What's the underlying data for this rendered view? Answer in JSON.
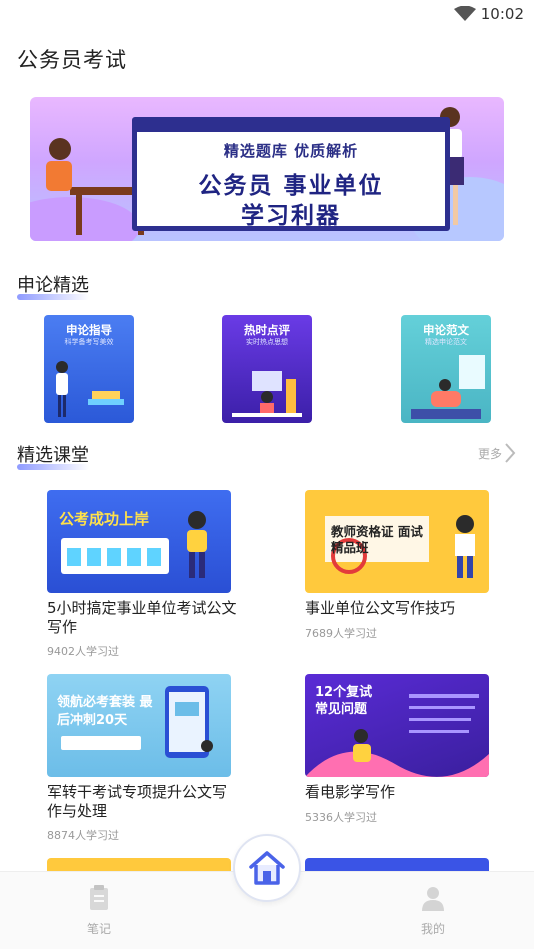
{
  "status_bar": {
    "time": "10:02"
  },
  "app": {
    "title": "公务员考试"
  },
  "banner": {
    "subtitle": "精选题库 优质解析",
    "line1": "公务员 事业单位",
    "line2": "学习利器"
  },
  "shenlun": {
    "section_title": "申论精选",
    "cards": [
      {
        "title": "申论指导",
        "subtitle": "科学备考写美效"
      },
      {
        "title": "热时点评",
        "subtitle": "实时热点思想"
      },
      {
        "title": "申论范文",
        "subtitle": "精选申论范文"
      }
    ]
  },
  "courses": {
    "section_title": "精选课堂",
    "more_label": "更多",
    "items": [
      {
        "title": "5小时搞定事业单位考试公文写作",
        "learners": "9402人学习过",
        "thumb_text": "公考成功上岸"
      },
      {
        "title": "事业单位公文写作技巧",
        "learners": "7689人学习过",
        "thumb_text": "教师资格证 面试精品班"
      },
      {
        "title": "军转干考试专项提升公文写作与处理",
        "learners": "8874人学习过",
        "thumb_text": "领航必考套装 最后冲刺20天"
      },
      {
        "title": "看电影学写作",
        "learners": "5336人学习过",
        "thumb_text": "12个复试 常见问题"
      }
    ]
  },
  "bottom_nav": {
    "notes_label": "笔记",
    "mine_label": "我的"
  },
  "colors": {
    "accent": "#4a63e8",
    "underline": "#8f9bff"
  }
}
